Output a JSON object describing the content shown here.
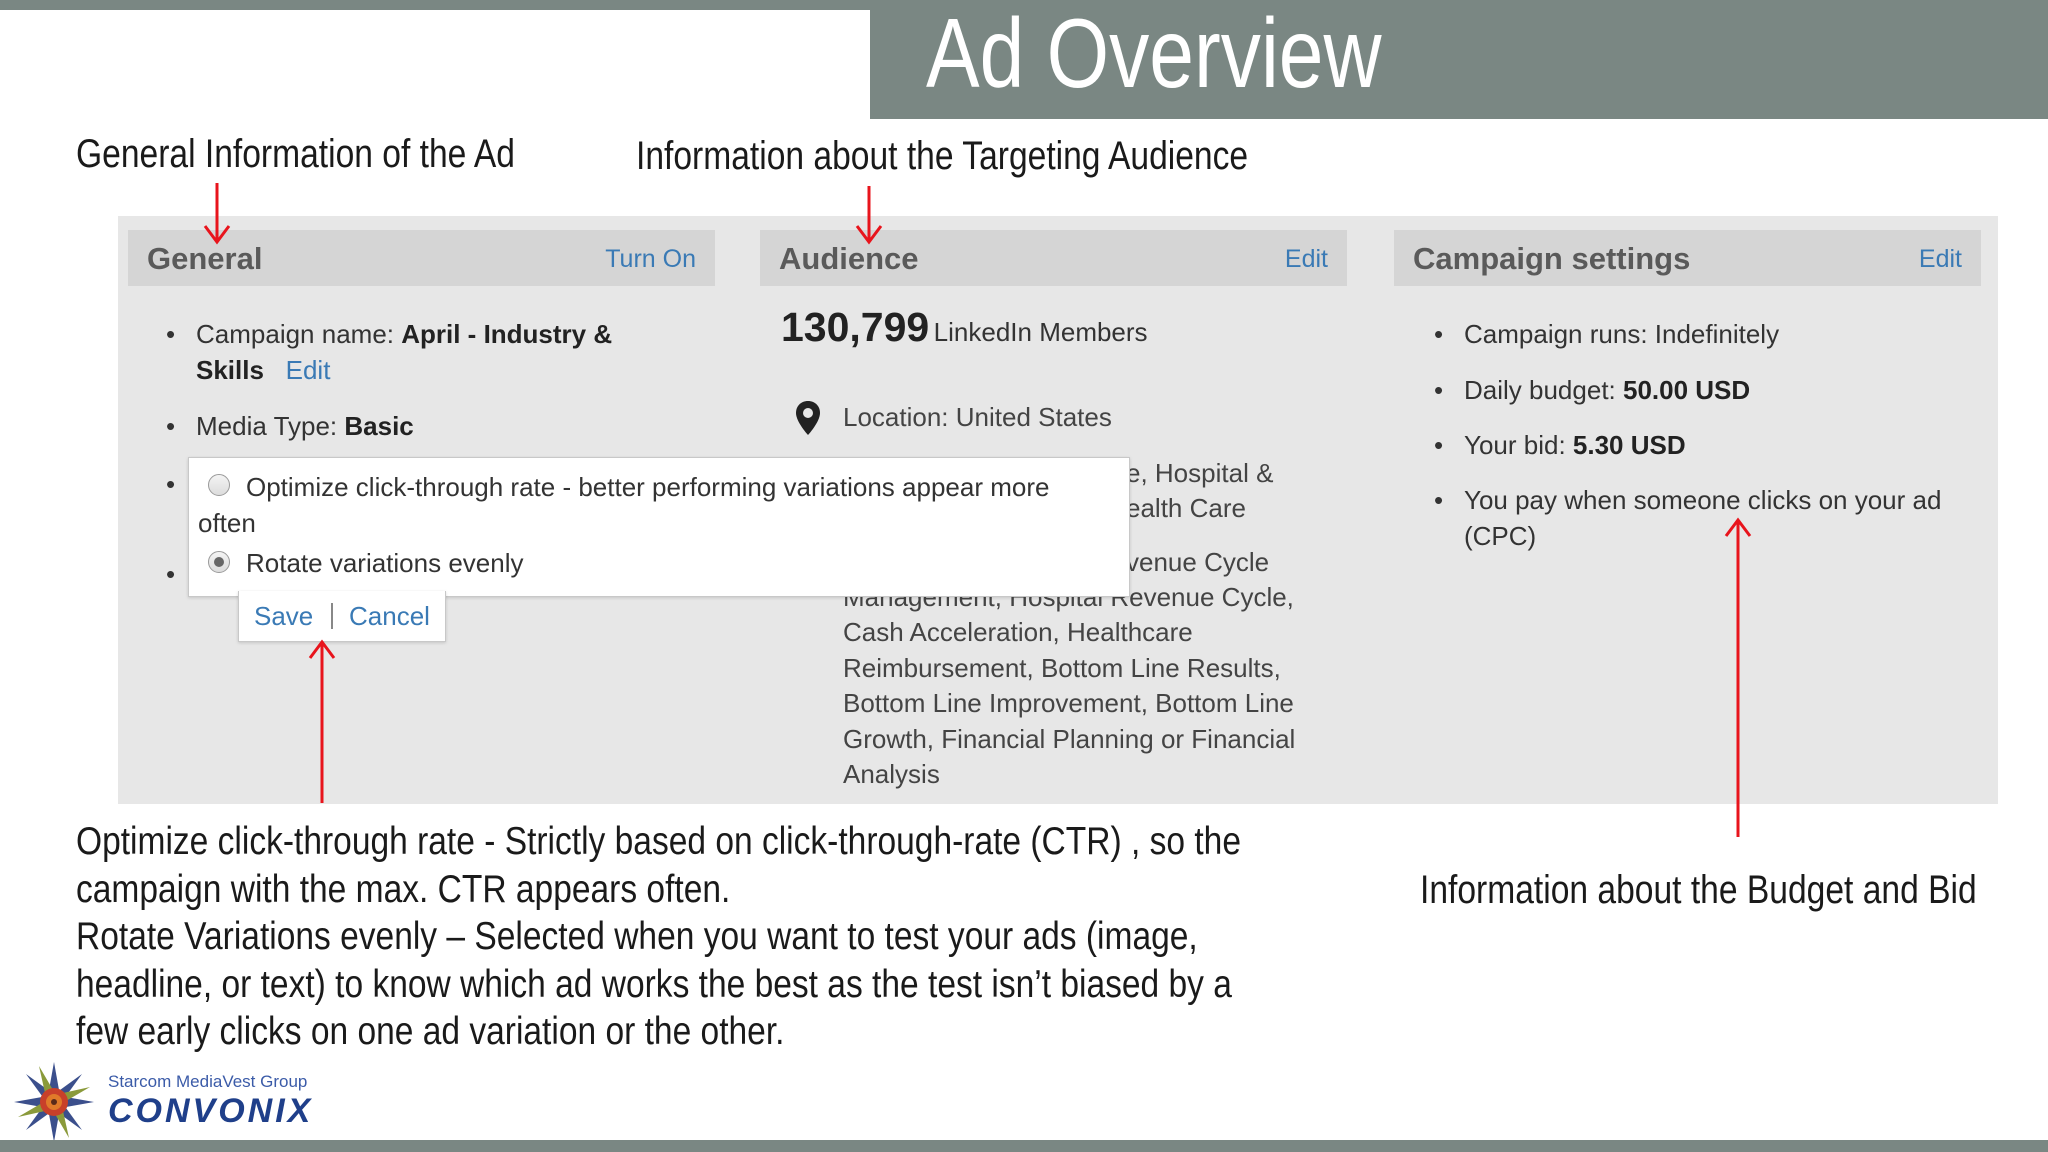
{
  "slide": {
    "title": "Ad Overview",
    "caption_general": "General Information of the Ad",
    "caption_audience": "Information about the Targeting Audience",
    "caption_budget": "Information about the Budget and Bid",
    "note_lines": [
      "Optimize click-through rate - Strictly based on click-through-rate (CTR) , so the",
      "campaign with the max. CTR  appears often.",
      "Rotate Variations evenly – Selected when you want to test your ads (image,",
      "headline, or text)  to know which ad works the best as the test isn’t biased by a",
      "few early clicks on one ad variation or the other."
    ]
  },
  "general": {
    "heading": "General",
    "action": "Turn On",
    "campaign_label": "Campaign name: ",
    "campaign_value_1": "April - Industry &",
    "campaign_value_2": "Skills",
    "campaign_edit": "Edit",
    "media_label": "Media Type: ",
    "media_value": "Basic"
  },
  "rotation_popup": {
    "option1_line1": "Optimize click-through rate - better performing variations appear more",
    "option1_line2": "often",
    "option2": "Rotate variations evenly",
    "selected": "Rotate variations evenly",
    "save": "Save",
    "cancel": "Cancel"
  },
  "audience": {
    "heading": "Audience",
    "action": "Edit",
    "count": "130,799",
    "count_label": "LinkedIn Members",
    "location": "Location: United States",
    "industry_partial_1": "e, Hospital &",
    "industry_partial_2": "ealth Care",
    "skills_partial_1": "venue Cycle",
    "skills_partial_2": "Management, Hospital Revenue Cycle,",
    "skills_lines": [
      "Cash Acceleration, Healthcare",
      "Reimbursement, Bottom Line Results,",
      "Bottom Line Improvement, Bottom Line",
      "Growth, Financial Planning or Financial",
      "Analysis"
    ]
  },
  "campaign": {
    "heading": "Campaign settings",
    "action": "Edit",
    "runs_label": "Campaign runs: ",
    "runs_value": "Indefinitely",
    "budget_label": "Daily budget: ",
    "budget_value": "50.00 USD",
    "bid_label": "Your bid: ",
    "bid_value": "5.30 USD",
    "pay_line1": "You pay when someone clicks on your ad",
    "pay_line2": "(CPC)"
  },
  "logo": {
    "line1": "Starcom MediaVest Group",
    "line2": "CONVONIX"
  },
  "colors": {
    "banner": "#7a8783",
    "arrow": "#e8141c",
    "link": "#3a7ab5",
    "panel": "#e7e7e7",
    "header": "#d5d5d5"
  }
}
